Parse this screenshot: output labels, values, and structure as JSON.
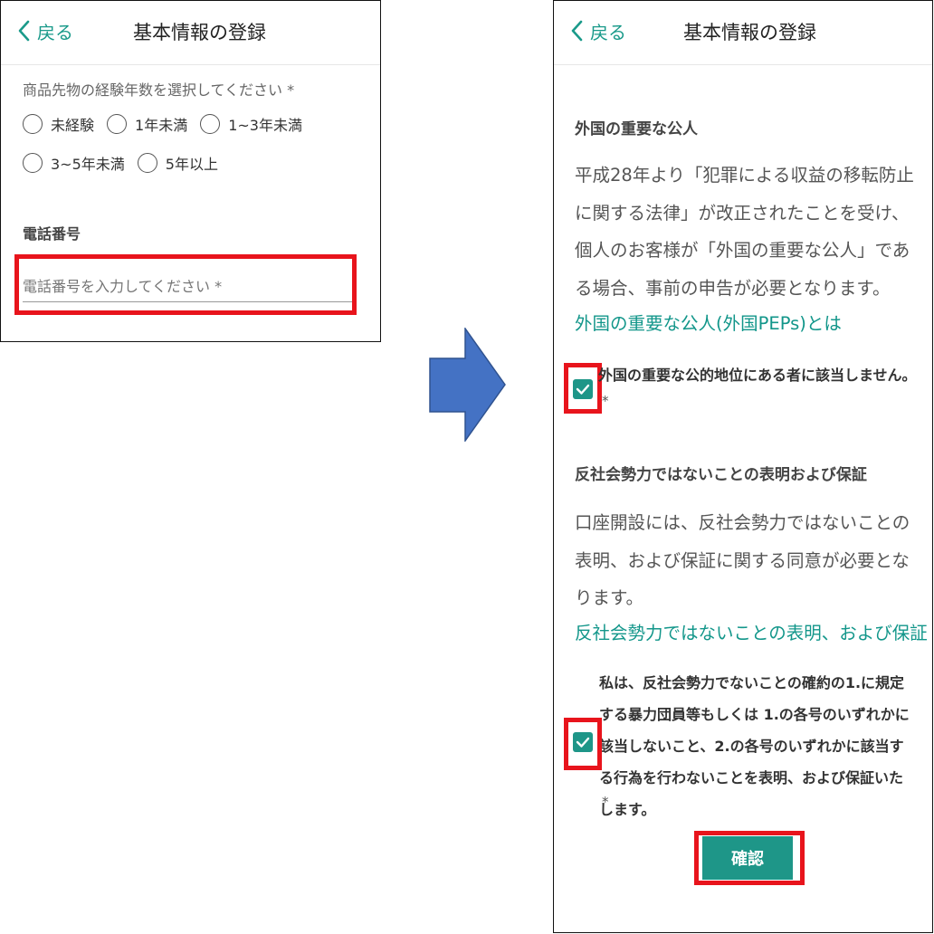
{
  "left": {
    "header": {
      "back_label": "戻る",
      "title": "基本情報の登録"
    },
    "experience": {
      "question": "商品先物の経験年数を選択してください *",
      "options": [
        "未経験",
        "1年未満",
        "1~3年未満",
        "3~5年未満",
        "5年以上"
      ]
    },
    "phone": {
      "section_label": "電話番号",
      "placeholder": "電話番号を入力してください *"
    }
  },
  "right": {
    "header": {
      "back_label": "戻る",
      "title": "基本情報の登録"
    },
    "peps": {
      "heading": "外国の重要な公人",
      "body": "平成28年より「犯罪による収益の移転防止に関する法律」が改正されたことを受け、個人のお客様が「外国の重要な公人」である場合、事前の申告が必要となります。",
      "link": "外国の重要な公人(外国PEPs)とは",
      "checkbox_label": "外国の重要な公的地位にある者に該当しません。",
      "required_mark": "*",
      "checked": true
    },
    "antisocial": {
      "heading": "反社会勢力ではないことの表明および保証",
      "body": "口座開設には、反社会勢力ではないことの表明、および保証に関する同意が必要となります。",
      "link": "反社会勢力ではないことの表明、および保証",
      "checkbox_label": "私は、反社会勢力でないことの確約の1.に規定する暴力団員等もしくは 1.の各号のいずれかに該当しないこと、2.の各号のいずれかに該当する行為を行わないことを表明、および保証いたします。",
      "required_mark": "*",
      "checked": true
    },
    "confirm_button": "確認"
  },
  "colors": {
    "accent": "#1e9688",
    "highlight": "#e8141c",
    "arrow": "#4472c4"
  },
  "icons": {
    "back": "chevron-left-icon",
    "arrow": "right-arrow-icon",
    "check": "check-icon"
  }
}
